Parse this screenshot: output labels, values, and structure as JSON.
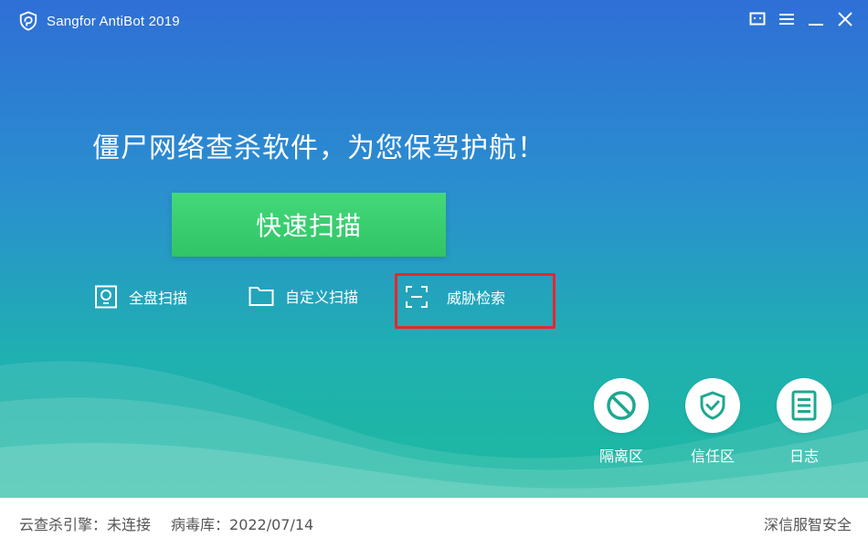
{
  "titlebar": {
    "title": "Sangfor AntiBot 2019",
    "logo_icon": "shield-logo-icon",
    "controls": [
      "feedback-icon",
      "menu-icon",
      "minimize-icon",
      "close-icon"
    ]
  },
  "main": {
    "slogan": "僵尸网络查杀软件，为您保驾护航！",
    "quick_scan_label": "快速扫描",
    "scan_options": [
      {
        "label": "全盘扫描",
        "icon": "disk-icon"
      },
      {
        "label": "自定义扫描",
        "icon": "folder-icon"
      },
      {
        "label": "威胁检索",
        "icon": "scan-frame-icon"
      }
    ],
    "highlight_color": "#e8262b"
  },
  "tools": [
    {
      "label": "隔离区",
      "icon": "ban-icon"
    },
    {
      "label": "信任区",
      "icon": "shield-check-icon"
    },
    {
      "label": "日志",
      "icon": "log-icon"
    }
  ],
  "statusbar": {
    "engine": "云查杀引擎：未连接",
    "virus_db": "病毒库：2022/07/14",
    "brand": "深信服智安全"
  },
  "colors": {
    "accent_green": "#30c467",
    "icon_teal": "#1ea88f",
    "bg_top": "#2f6fd6",
    "bg_bottom": "#1dbd98"
  }
}
